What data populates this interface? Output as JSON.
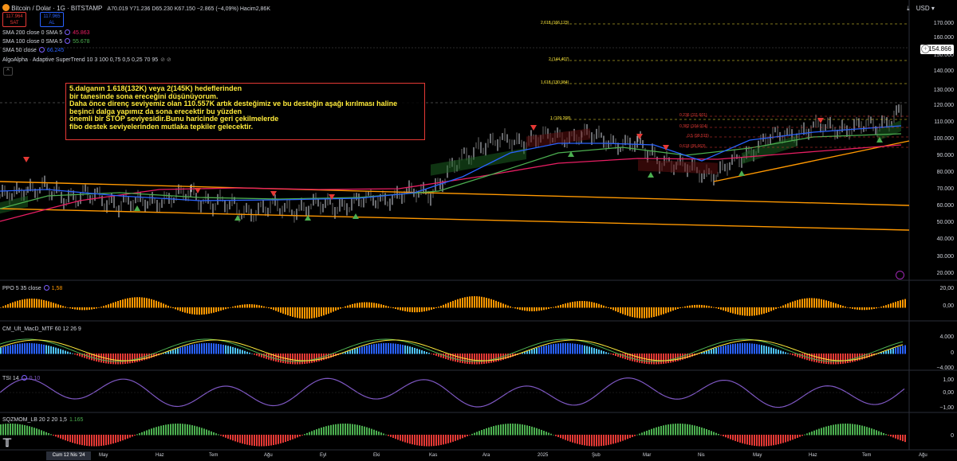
{
  "header": {
    "symbol": "Bitcoin / Dolar · 1G · BITSTAMP",
    "ohlc": "A70.019 Y71.236 D65.230 K67.150 −2.865 (−4,09%) Hacim2,86K",
    "currency": "USD",
    "sell_price": "117.964",
    "sell_label": "SAT",
    "buy_price": "117.965",
    "buy_label": "AL"
  },
  "indicators": [
    {
      "label": "SMA 200 close 0 SMA 5",
      "value": "45.863",
      "color": "#e91e63"
    },
    {
      "label": "SMA 100 close 0 SMA 5",
      "value": "55.678",
      "color": "#4caf50"
    },
    {
      "label": "SMA 50 close",
      "value": "66.245",
      "color": "#2962ff"
    },
    {
      "label": "AlgoAlpha · Adaptive SuperTrend 10 3 100 0,75 0,5 0,25 70 95",
      "value": "",
      "color": "#d1d4dc"
    }
  ],
  "annotation": [
    "5.dalganın 1.618(132K) veya 2(145K) hedeflerinden",
    "bir tanesinde sona ereceğini düşünüyorum.",
    "Daha önce direnç seviyemiz olan 110.557K artık desteğimiz ve bu desteğin aşağı kırılması haline",
    "beşinci dalga yapımız da sona erecektir bu yüzden",
    "önemli bir STOP seviyesidir.Bunu haricinde geri çekilmelerde",
    "fibo destek seviyelerinden mutlaka tepkiler gelecektir."
  ],
  "fib_levels": [
    {
      "label": "2,618 (166.123)",
      "color": "#ffeb3b"
    },
    {
      "label": "2 (144.407)",
      "color": "#ffeb3b"
    },
    {
      "label": "1,618 (130.984)",
      "color": "#ffeb3b"
    },
    {
      "label": "1 (109.268)",
      "color": "#ffeb3b"
    },
    {
      "label": "0,236 (111.601)",
      "color": "#e53935"
    },
    {
      "label": "0,382 (104.914)",
      "color": "#e53935"
    },
    {
      "label": "0,5 (99.515)",
      "color": "#e53935"
    },
    {
      "label": "0,618 (95.663)",
      "color": "#e53935"
    }
  ],
  "price_axis": {
    "ticks": [
      "170.000",
      "160.000",
      "150.000",
      "140.000",
      "130.000",
      "120.000",
      "110.000",
      "100.000",
      "90.000",
      "80.000",
      "70.000",
      "60.000",
      "50.000",
      "40.000",
      "30.000",
      "20.000"
    ],
    "current_price": "154.866"
  },
  "time_axis": {
    "labels": [
      "May",
      "Haz",
      "Tem",
      "Ağu",
      "Eyl",
      "Eki",
      "Kas",
      "Ara",
      "2025",
      "Şub",
      "Mar",
      "Nis",
      "May",
      "Haz",
      "Tem",
      "Ağu"
    ],
    "cursor_label": "Cum 12 Nis '24"
  },
  "panes": [
    {
      "label": "PPO 5 35 close",
      "value": "1,58",
      "value_color": "#ff9800",
      "ticks": [
        "20,00",
        "0,00"
      ]
    },
    {
      "label": "CM_Ult_MacD_MTF 60 12 26 9",
      "value": "",
      "value_color": "#d1d4dc",
      "ticks": [
        "4.000",
        "0",
        "−4.000"
      ]
    },
    {
      "label": "TSI 14",
      "value": "0,10",
      "value_color": "#7e57c2",
      "ticks": [
        "1,00",
        "0,00",
        "−1,00"
      ]
    },
    {
      "label": "SQZMOM_LB 20 2 20 1,5",
      "value": "1.165",
      "value_color": "#4caf50",
      "ticks": [
        "0"
      ]
    }
  ],
  "colors": {
    "background": "#000000",
    "sma200": "#e91e63",
    "sma100": "#4caf50",
    "sma50": "#2962ff",
    "channel": "#ff9800",
    "supertrend_up": "#1b5e20",
    "supertrend_down": "#5d0f0f"
  }
}
